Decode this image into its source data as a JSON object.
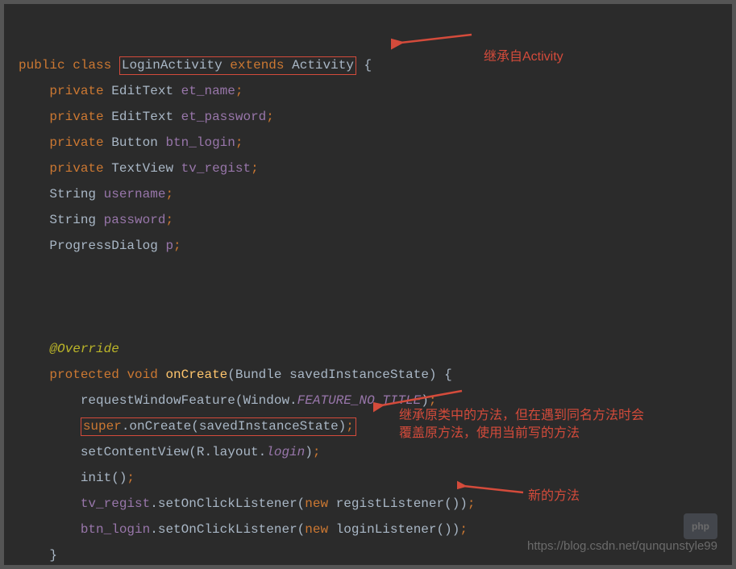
{
  "code": {
    "l1_public": "public",
    "l1_class": "class",
    "l1_name": "LoginActivity",
    "l1_extends": "extends",
    "l1_super": "Activity",
    "l1_brace": " {",
    "l2_priv": "private",
    "l2_type": "EditText",
    "l2_field": "et_name",
    "l3_priv": "private",
    "l3_type": "EditText",
    "l3_field": "et_password",
    "l4_priv": "private",
    "l4_type": "Button",
    "l4_field": "btn_login",
    "l5_priv": "private",
    "l5_type": "TextView",
    "l5_field": "tv_regist",
    "l6_type": "String",
    "l6_field": "username",
    "l7_type": "String",
    "l7_field": "password",
    "l8_type": "ProgressDialog",
    "l8_field": "p",
    "ann_override": "@Override",
    "mod_protected": "protected",
    "mod_void": "void",
    "m_oncreate": "onCreate",
    "p_bundle": "Bundle savedInstanceState",
    "call_reqwin": "requestWindowFeature(Window.",
    "const_feature": "FEATURE_NO_TITLE",
    "call_reqwin_end": ")",
    "super": "super",
    "super_oncreate": ".onCreate(savedInstanceState)",
    "call_setcontent": "setContentView(R.layout.",
    "layout_login": "login",
    "call_setcontent_end": ")",
    "call_init": "init()",
    "tv_regist": "tv_regist",
    "btn_login": "btn_login",
    "setclick": ".setOnClickListener(",
    "kw_new": "new",
    "reg_listener": " registListener())",
    "login_listener": " loginListener())",
    "semi": ";",
    "close_brace": "}"
  },
  "annotations": {
    "a1": "继承自Activity",
    "a2_line1": "继承原类中的方法，但在遇到同名方法时会",
    "a2_line2": "覆盖原方法，使用当前写的方法",
    "a3": "新的方法"
  },
  "watermark": "https://blog.csdn.net/qunqunstyle99"
}
